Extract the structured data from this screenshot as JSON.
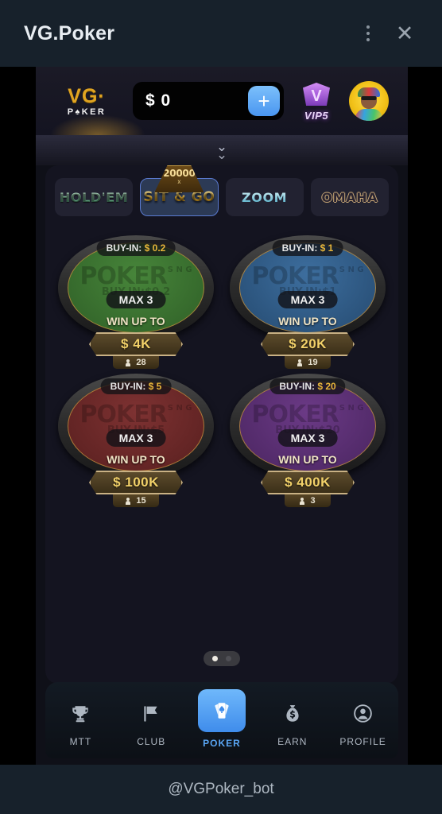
{
  "window": {
    "title": "VG.Poker",
    "menu_icon": "more-vertical-icon",
    "close_icon": "close-icon"
  },
  "footer": {
    "bot_handle": "@VGPoker_bot"
  },
  "topbar": {
    "brand_line1": "VG·",
    "brand_line2": "P♠KER",
    "balance_currency": "$",
    "balance_value": "0",
    "add_funds_label": "+",
    "vip_letter": "V",
    "vip_label": "VIP5",
    "avatar_name": "player-avatar"
  },
  "collapse": {
    "icon": "double-chevron-down-icon",
    "glyph": "⌄"
  },
  "tabs": [
    {
      "label": "HOLD'EM",
      "key": "holdem",
      "active": false
    },
    {
      "label": "SIT & GO",
      "key": "sitgo",
      "active": true,
      "badge_number": "20000",
      "badge_x": "x"
    },
    {
      "label": "ZOOM",
      "key": "zoom",
      "active": false
    },
    {
      "label": "OMAHA",
      "key": "omaha",
      "active": false
    }
  ],
  "tables": [
    {
      "color": "green",
      "buyin_label": "BUY-IN:",
      "buyin_value": "$ 0.2",
      "watermark": "POKER",
      "watermark_sng": "S N G",
      "watermark_sub": "BUY-IN:$0.2",
      "max_label": "MAX 3",
      "win_label": "WIN UP TO",
      "prize": "$ 4K",
      "players": "28"
    },
    {
      "color": "blue",
      "buyin_label": "BUY-IN:",
      "buyin_value": "$ 1",
      "watermark": "POKER",
      "watermark_sng": "S N G",
      "watermark_sub": "BUY-IN:$1",
      "max_label": "MAX 3",
      "win_label": "WIN UP TO",
      "prize": "$ 20K",
      "players": "19"
    },
    {
      "color": "red",
      "buyin_label": "BUY-IN:",
      "buyin_value": "$ 5",
      "watermark": "POKER",
      "watermark_sng": "S N G",
      "watermark_sub": "BUY-IN:$5",
      "max_label": "MAX 3",
      "win_label": "WIN UP TO",
      "prize": "$ 100K",
      "players": "15"
    },
    {
      "color": "purple",
      "buyin_label": "BUY-IN:",
      "buyin_value": "$ 20",
      "watermark": "POKER",
      "watermark_sng": "S N G",
      "watermark_sub": "BUY-IN:$20",
      "max_label": "MAX 3",
      "win_label": "WIN UP TO",
      "prize": "$ 400K",
      "players": "3"
    }
  ],
  "pager": {
    "total": 2,
    "active_index": 0
  },
  "nav": [
    {
      "label": "MTT",
      "icon": "trophy-icon",
      "active": false
    },
    {
      "label": "CLUB",
      "icon": "flag-icon",
      "active": false
    },
    {
      "label": "POKER",
      "icon": "playing-cards-icon",
      "active": true
    },
    {
      "label": "EARN",
      "icon": "money-bag-icon",
      "active": false
    },
    {
      "label": "PROFILE",
      "icon": "person-circle-icon",
      "active": false
    }
  ],
  "colors": {
    "accent_blue": "#4a96f0",
    "gold": "#e0a421",
    "header_bg": "#17212b",
    "panel_bg": "#141420"
  }
}
